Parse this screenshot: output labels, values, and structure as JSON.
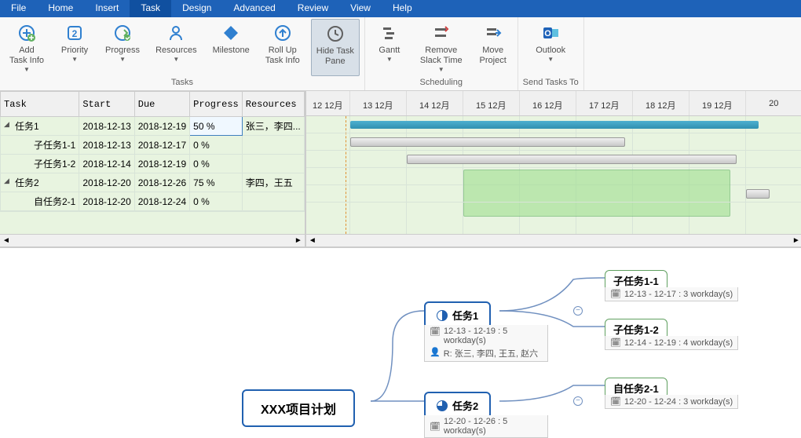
{
  "menu": [
    "File",
    "Home",
    "Insert",
    "Task",
    "Design",
    "Advanced",
    "Review",
    "View",
    "Help"
  ],
  "menu_active": "Task",
  "ribbon": {
    "groups": [
      {
        "label": "Tasks",
        "items": [
          {
            "name": "add-task-info",
            "label": "Add\nTask Info",
            "icon": "plus-circle",
            "dd": true
          },
          {
            "name": "priority",
            "label": "Priority",
            "icon": "priority",
            "dd": true
          },
          {
            "name": "progress",
            "label": "Progress",
            "icon": "progress",
            "dd": true
          },
          {
            "name": "resources",
            "label": "Resources",
            "icon": "person",
            "dd": true
          },
          {
            "name": "milestone",
            "label": "Milestone",
            "icon": "diamond"
          },
          {
            "name": "roll-up",
            "label": "Roll Up\nTask Info",
            "icon": "rollup"
          },
          {
            "name": "hide-task-pane",
            "label": "Hide Task\nPane",
            "icon": "clock",
            "active": true
          }
        ]
      },
      {
        "label": "Scheduling",
        "items": [
          {
            "name": "gantt",
            "label": "Gantt",
            "icon": "gantt",
            "dd": true
          },
          {
            "name": "remove-slack",
            "label": "Remove\nSlack Time",
            "icon": "slack",
            "dd": true
          },
          {
            "name": "move-project",
            "label": "Move\nProject",
            "icon": "move"
          }
        ]
      },
      {
        "label": "Send Tasks To",
        "items": [
          {
            "name": "outlook",
            "label": "Outlook",
            "icon": "outlook",
            "dd": true
          }
        ]
      }
    ]
  },
  "table": {
    "columns": [
      "Task",
      "Start",
      "Due",
      "Progress",
      "Resources"
    ],
    "rows": [
      {
        "task": "任务1",
        "indent": 0,
        "exp": true,
        "start": "2018-12-13",
        "due": "2018-12-19",
        "progress": "50 %",
        "res": "张三，李四..."
      },
      {
        "task": "子任务1-1",
        "indent": 1,
        "start": "2018-12-13",
        "due": "2018-12-17",
        "progress": "0 %",
        "res": ""
      },
      {
        "task": "子任务1-2",
        "indent": 1,
        "start": "2018-12-14",
        "due": "2018-12-19",
        "progress": "0 %",
        "res": ""
      },
      {
        "task": "任务2",
        "indent": 0,
        "exp": true,
        "start": "2018-12-20",
        "due": "2018-12-26",
        "progress": "75 %",
        "res": "李四，王五"
      },
      {
        "task": "自任务2-1",
        "indent": 1,
        "start": "2018-12-20",
        "due": "2018-12-24",
        "progress": "0 %",
        "res": ""
      }
    ],
    "selected_row": 0,
    "selected_col": "progress"
  },
  "gantt": {
    "columns": [
      "12 12月",
      "13 12月",
      "14 12月",
      "15 12月",
      "16 12月",
      "17 12月",
      "18 12月",
      "19 12月",
      "20"
    ]
  },
  "mindmap": {
    "root": "XXX项目计划",
    "nodes": [
      {
        "id": "t1",
        "label": "任务1",
        "detail_date": "12-13 - 12-19 : 5 workday(s)",
        "detail_res": "R: 张三, 李四, 王五, 赵六",
        "progress": 50
      },
      {
        "id": "t2",
        "label": "任务2",
        "detail_date": "12-20 - 12-26 : 5 workday(s)",
        "progress": 75
      },
      {
        "id": "s11",
        "label": "子任务1-1",
        "detail": "12-13 - 12-17 : 3 workday(s)"
      },
      {
        "id": "s12",
        "label": "子任务1-2",
        "detail": "12-14 - 12-19 : 4 workday(s)"
      },
      {
        "id": "s21",
        "label": "自任务2-1",
        "detail": "12-20 - 12-24 : 3 workday(s)"
      }
    ]
  }
}
